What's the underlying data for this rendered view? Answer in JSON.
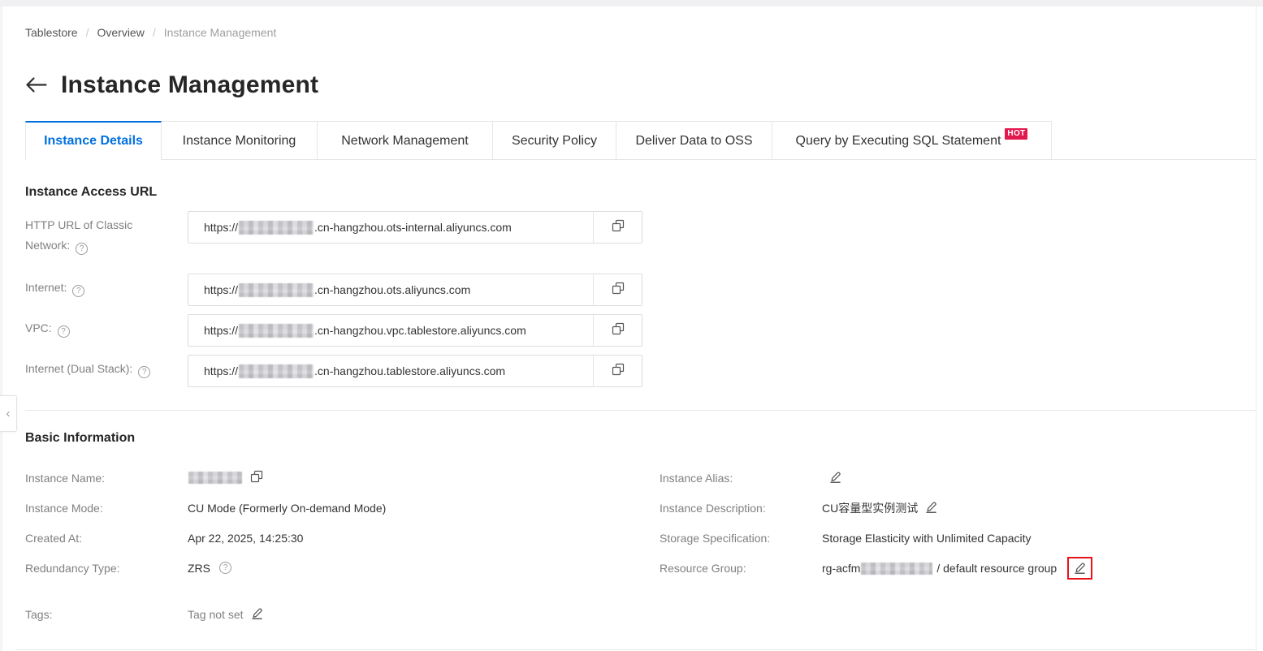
{
  "breadcrumb": {
    "items": [
      {
        "label": "Tablestore",
        "current": false
      },
      {
        "label": "Overview",
        "current": false
      },
      {
        "label": "Instance Management",
        "current": true
      }
    ],
    "separator": "/"
  },
  "page": {
    "title": "Instance Management"
  },
  "tabs": [
    {
      "label": "Instance Details",
      "active": true
    },
    {
      "label": "Instance Monitoring",
      "active": false
    },
    {
      "label": "Network Management",
      "active": false
    },
    {
      "label": "Security Policy",
      "active": false
    },
    {
      "label": "Deliver Data to OSS",
      "active": false
    },
    {
      "label": "Query by Executing SQL Statement",
      "active": false,
      "badge": "HOT"
    }
  ],
  "access_url_section": {
    "title": "Instance Access URL",
    "rows": [
      {
        "label": "HTTP URL of Classic Network:",
        "url_prefix": "https://",
        "url_suffix": ".cn-hangzhou.ots-internal.aliyuncs.com",
        "redacted": true
      },
      {
        "label": "Internet:",
        "url_prefix": "https://",
        "url_suffix": ".cn-hangzhou.ots.aliyuncs.com",
        "redacted": true
      },
      {
        "label": "VPC:",
        "url_prefix": "https://",
        "url_suffix": ".cn-hangzhou.vpc.tablestore.aliyuncs.com",
        "redacted": true
      },
      {
        "label": "Internet (Dual Stack):",
        "url_prefix": "https://",
        "url_suffix": ".cn-hangzhou.tablestore.aliyuncs.com",
        "redacted": true
      }
    ]
  },
  "basic_info": {
    "title": "Basic Information",
    "left": [
      {
        "label": "Instance Name:",
        "value": "",
        "redacted": true,
        "copyable": true
      },
      {
        "label": "Instance Mode:",
        "value": "CU Mode (Formerly On-demand Mode)"
      },
      {
        "label": "Created At:",
        "value": "Apr 22, 2025, 14:25:30"
      },
      {
        "label": "Redundancy Type:",
        "value": "ZRS",
        "help": true
      },
      {
        "label": "Tags:",
        "value": "Tag not set",
        "editable": true
      }
    ],
    "right": [
      {
        "label": "Instance Alias:",
        "value": "",
        "editable": true
      },
      {
        "label": "Instance Description:",
        "value": "CU容量型实例测试",
        "editable": true
      },
      {
        "label": "Storage Specification:",
        "value": "Storage Elasticity with Unlimited Capacity"
      },
      {
        "label": "Resource Group:",
        "value_prefix": "rg-acfm",
        "redacted": true,
        "value_suffix": " / default resource group",
        "editable": true,
        "highlighted": true
      }
    ]
  },
  "icons": {
    "back": "arrow-left-icon",
    "help": "question-mark-circle-icon",
    "copy": "copy-icon",
    "edit": "edit-pencil-icon",
    "collapse": "chevron-left-icon",
    "collapse_glyph": "‹",
    "help_glyph": "?"
  },
  "colors": {
    "accent_blue": "#0070e0",
    "hot_badge_red": "#e2194e",
    "highlight_red": "#e8131a",
    "label_gray": "#808080",
    "value_dark": "#333333",
    "border_gray": "#e6e6e6"
  }
}
